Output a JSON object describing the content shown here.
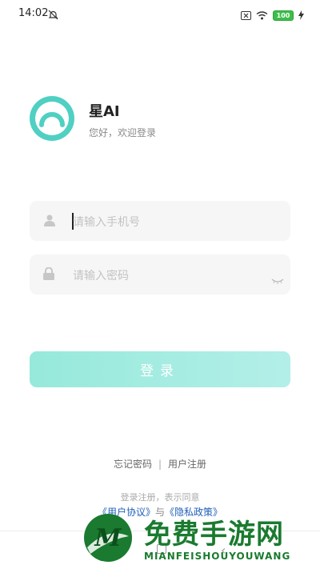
{
  "status_bar": {
    "time": "14:02",
    "icons": [
      "bell-off-icon",
      "sim-x-icon",
      "wifi-icon",
      "battery-icon",
      "charging-icon"
    ],
    "battery": "100"
  },
  "header": {
    "title": "星AI",
    "subtitle": "您好，欢迎登录",
    "logo_color": "#4fd0c2"
  },
  "form": {
    "phone_placeholder": "请输入手机号",
    "password_placeholder": "请输入密码",
    "login_label": "登录"
  },
  "links": {
    "forgot": "忘记密码",
    "separator": "|",
    "register": "用户注册"
  },
  "agreement": {
    "line1": "登录注册，表示同意",
    "user_agreement": "《用户协议》",
    "and": "与",
    "privacy_policy": "《隐私政策》"
  },
  "watermark": {
    "title": "免费手游网",
    "subtitle": "MIANFEISHOUYOUWANG"
  },
  "colors": {
    "accent": "#4fd0c2",
    "button_start": "#96e9db",
    "button_end": "#b3efe8",
    "link": "#1f5fb8",
    "watermark": "#1a7a2f"
  }
}
